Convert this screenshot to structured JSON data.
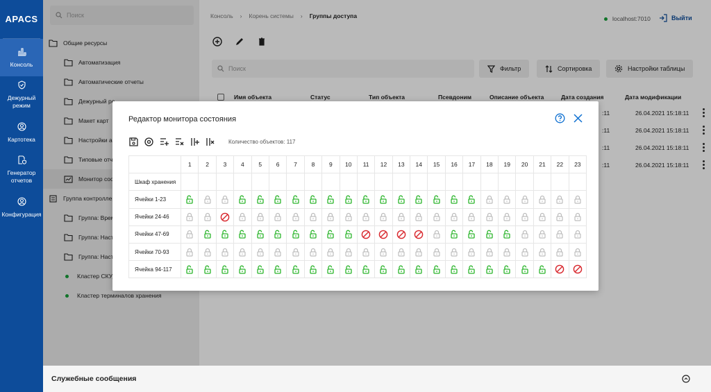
{
  "app": {
    "logo": "APACS"
  },
  "rail": [
    {
      "label": "Консоль",
      "icon": "chart-icon",
      "active": true
    },
    {
      "label": "Дежурный режим",
      "icon": "shield-icon",
      "active": false
    },
    {
      "label": "Картотека",
      "icon": "person-icon",
      "active": false
    },
    {
      "label": "Генератор отчетов",
      "icon": "report-shield-icon",
      "active": false
    },
    {
      "label": "Конфигурация",
      "icon": "person-settings-icon",
      "active": false
    }
  ],
  "tree": {
    "search_placeholder": "Поиск",
    "items": [
      {
        "label": "Общие ресурсы",
        "level": 0,
        "icon": "folder-icon"
      },
      {
        "label": "Автоматизация",
        "level": 1,
        "icon": "folder-icon"
      },
      {
        "label": "Автоматические отчеты",
        "level": 1,
        "icon": "folder-icon"
      },
      {
        "label": "Дежурный ре",
        "level": 1,
        "icon": "folder-icon"
      },
      {
        "label": "Макет карт",
        "level": 1,
        "icon": "folder-icon"
      },
      {
        "label": "Настройки ав",
        "level": 1,
        "icon": "folder-icon"
      },
      {
        "label": "Типовые отче",
        "level": 1,
        "icon": "folder-icon"
      },
      {
        "label": "Монитор сост",
        "level": 1,
        "icon": "monitor-icon",
        "selected": true
      },
      {
        "label": "Группа контроллер",
        "level": 0,
        "icon": "server-icon"
      },
      {
        "label": "Группа: Время",
        "level": 1,
        "icon": "folder-icon"
      },
      {
        "label": "Группа: Настр",
        "level": 1,
        "icon": "folder-icon"
      },
      {
        "label": "Группа: Настр",
        "level": 1,
        "icon": "folder-icon"
      },
      {
        "label": "Кластер СКУД",
        "level": 1,
        "icon": "dot"
      },
      {
        "label": "Кластер терминалов хранения",
        "level": 1,
        "icon": "dot"
      }
    ]
  },
  "header": {
    "breadcrumbs": [
      "Консоль",
      "Корень системы",
      "Группы доступа"
    ],
    "host": "localhost:7010",
    "exit_label": "Выйти"
  },
  "toolbar": {
    "search_placeholder": "Поиск",
    "filter_label": "Фильтр",
    "sort_label": "Сортировка",
    "settings_label": "Настройки таблицы"
  },
  "table": {
    "columns": [
      "Имя объекта",
      "Статус",
      "Тип объекта",
      "Псевдоним",
      "Описание объекта",
      "Дата создания",
      "Дата модификации"
    ],
    "rows": [
      {
        "created_tail": ":11",
        "modified": "26.04.2021 15:18:11"
      },
      {
        "created_tail": ":11",
        "modified": "26.04.2021 15:18:11"
      },
      {
        "created_tail": ":11",
        "modified": "26.04.2021 15:18:11"
      },
      {
        "created_tail": ":11",
        "modified": "26.04.2021 15:18:11"
      }
    ]
  },
  "footer": {
    "label": "Служебные сообщения"
  },
  "modal": {
    "title": "Редактор монитора состояния",
    "count_label": "Количество объектов: 117",
    "columns": [
      "1",
      "2",
      "3",
      "4",
      "5",
      "6",
      "7",
      "8",
      "9",
      "10",
      "11",
      "12",
      "13",
      "14",
      "15",
      "16",
      "17",
      "18",
      "19",
      "20",
      "21",
      "22",
      "23"
    ],
    "rows": [
      {
        "label": "Шкаф хранения",
        "cells": "eeeeeeeeeeeeeeeeeeeeeee"
      },
      {
        "label": "Ячейки 1-23",
        "cells": "oggoooooooooooooogggggg"
      },
      {
        "label": "Ячейки 24-46",
        "cells": "gglggggggggggggggggggggg"
      },
      {
        "label": "Ячейки 47-69",
        "cells": "gooooooooollllgooooggggg"
      },
      {
        "label": "Ячейки 70-93",
        "cells": "ggggggggggggggggggggggg"
      },
      {
        "label": "Ячейка 94-117",
        "cells": "ooooooooooooooooooooolll"
      }
    ],
    "legend": {
      "o": "open-lock-icon",
      "g": "locked-icon",
      "l": "blocked-icon",
      "e": "empty"
    },
    "colors": {
      "open": "#2bb52b",
      "locked": "#bdbdbd",
      "blocked": "#d8262c",
      "accent": "#0d6fd1"
    }
  }
}
